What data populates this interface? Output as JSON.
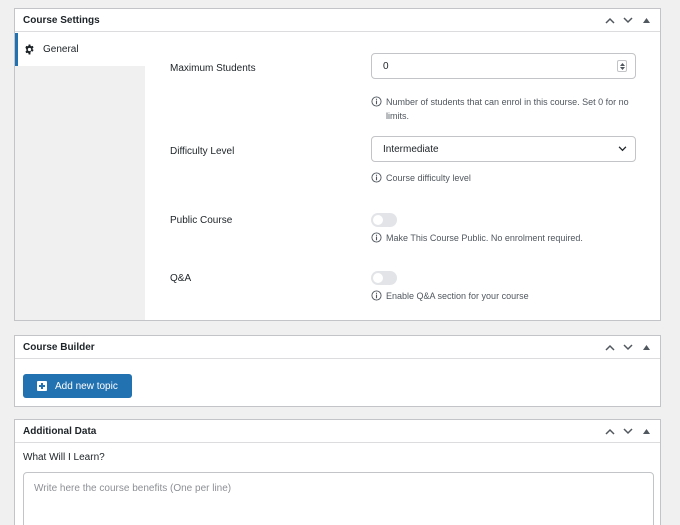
{
  "course_settings": {
    "title": "Course Settings",
    "tabs": [
      {
        "label": "General",
        "icon": "gear-icon"
      }
    ],
    "fields": {
      "max_students": {
        "label": "Maximum Students",
        "value": "0",
        "help": "Number of students that can enrol in this course. Set 0 for no limits."
      },
      "difficulty": {
        "label": "Difficulty Level",
        "value": "Intermediate",
        "help": "Course difficulty level"
      },
      "public_course": {
        "label": "Public Course",
        "enabled": false,
        "help": "Make This Course Public. No enrolment required."
      },
      "qa": {
        "label": "Q&A",
        "enabled": false,
        "help": "Enable Q&A section for your course"
      }
    }
  },
  "course_builder": {
    "title": "Course Builder",
    "add_topic_label": "Add new topic"
  },
  "additional_data": {
    "title": "Additional Data",
    "what_will_i_learn_label": "What Will I Learn?",
    "what_will_i_learn_placeholder": "Write here the course benefits (One per line)"
  },
  "colors": {
    "accent": "#2271b1",
    "border": "#c3c4c7",
    "sidebar_bg": "#f0f0f1"
  }
}
